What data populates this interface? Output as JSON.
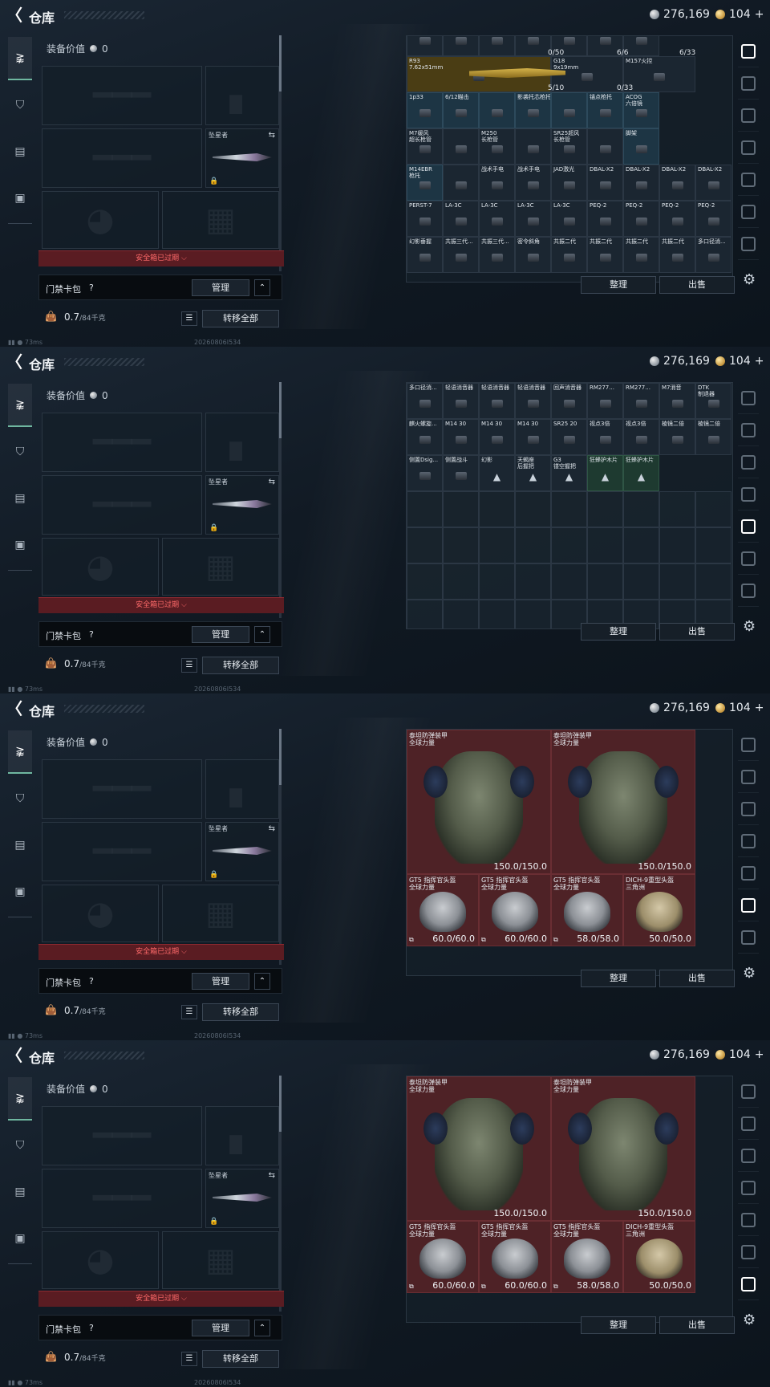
{
  "header": {
    "back_icon": "back-arrow-icon",
    "title": "仓库",
    "silver_amount": "276,169",
    "gold_amount": "104",
    "plus": "+"
  },
  "status": {
    "ping": "73ms",
    "build": "20260806I534"
  },
  "left_nav": [
    "gun-icon",
    "helmet-icon",
    "vest-icon",
    "backpack-icon"
  ],
  "loadout": {
    "equip_value_label": "装备价值",
    "equip_value": "0",
    "knife_label": "坠星者",
    "safe_expired": "安全箱已过期",
    "card_pack_label": "门禁卡包",
    "card_pack_q": "?",
    "manage": "管理",
    "weight": "0.7",
    "weight_cap": "/84千克",
    "transfer_all": "转移全部"
  },
  "actions": {
    "sort": "整理",
    "sell": "出售"
  },
  "frame1": {
    "cells": [
      [
        "",
        "",
        "",
        "",
        "",
        "",
        ""
      ],
      [
        "R93\n7.62x51mm",
        "",
        "",
        "",
        "G18\n9x19mm",
        "",
        "M157火控"
      ],
      [
        "1p33",
        "6/12瞄击",
        "",
        "影袭托芯枪托",
        "",
        "锚点枪托",
        "ACOG\n六倍镜"
      ],
      [
        "M7缓风\n超长枪管",
        "",
        "M250\n长枪管",
        "",
        "SR25超风\n长枪管",
        "",
        "脚架"
      ],
      [
        "M14EBR\n枪托",
        "",
        "战术手电",
        "战术手电",
        "JAD激光",
        "DBAL-X2",
        "DBAL-X2",
        "DBAL-X2",
        "DBAL-X2"
      ],
      [
        "PERST-7",
        "LA-3C",
        "LA-3C",
        "LA-3C",
        "LA-3C",
        "PEQ-2",
        "PEQ-2",
        "PEQ-2",
        "PEQ-2"
      ],
      [
        "幻影垂握",
        "共振三代...",
        "共振三代...",
        "密令斜角",
        "共振二代",
        "共振二代",
        "共振二代",
        "共振二代",
        "多口径消..."
      ]
    ],
    "counts": [
      "0/50",
      "6/6",
      "6/33",
      "5/10",
      "0/33"
    ]
  },
  "frame2": {
    "rows": [
      [
        "多口径消...",
        "轻语消音器",
        "轻语消音器",
        "轻语消音器",
        "回声消音器",
        "RM277...",
        "RM277...",
        "M7消音",
        "DTK\n制退器"
      ],
      [
        "麒火螺旋...",
        "M14 30",
        "M14 30",
        "M14 30",
        "SR25 20",
        "视点3倍",
        "视点3倍",
        "棱镜二倍",
        "棱镜二倍"
      ],
      [
        "侧置Dsig...",
        "侧置战斗",
        "幻影",
        "天蝎座\n后握把",
        "G3\n镂空握把",
        "狂蜂护木片",
        "狂蜂护木片"
      ]
    ]
  },
  "frame3": {
    "armors": [
      {
        "name": "泰坦防弹装甲\n全球力量",
        "dur": "150.0/150.0"
      },
      {
        "name": "泰坦防弹装甲\n全球力量",
        "dur": "150.0/150.0"
      }
    ],
    "helmets": [
      {
        "name": "GT5 指挥官头盔\n全球力量",
        "dur": "60.0/60.0"
      },
      {
        "name": "GT5 指挥官头盔\n全球力量",
        "dur": "60.0/60.0"
      },
      {
        "name": "GT5 指挥官头盔\n全球力量",
        "dur": "58.0/58.0"
      },
      {
        "name": "DICH-9重型头盔\n三角洲",
        "dur": "50.0/50.0"
      }
    ]
  },
  "frame4": {
    "armors": [
      {
        "name": "泰坦防弹装甲\n全球力量",
        "dur": "150.0/150.0"
      },
      {
        "name": "泰坦防弹装甲\n全球力量",
        "dur": "150.0/150.0"
      }
    ],
    "helmets": [
      {
        "name": "GT5 指挥官头盔\n全球力量",
        "dur": "60.0/60.0"
      },
      {
        "name": "GT5 指挥官头盔\n全球力量",
        "dur": "60.0/60.0"
      },
      {
        "name": "GT5 指挥官头盔\n全球力量",
        "dur": "58.0/58.0"
      },
      {
        "name": "DICH-9重型头盔\n三角洲",
        "dur": "50.0/50.0"
      }
    ]
  }
}
